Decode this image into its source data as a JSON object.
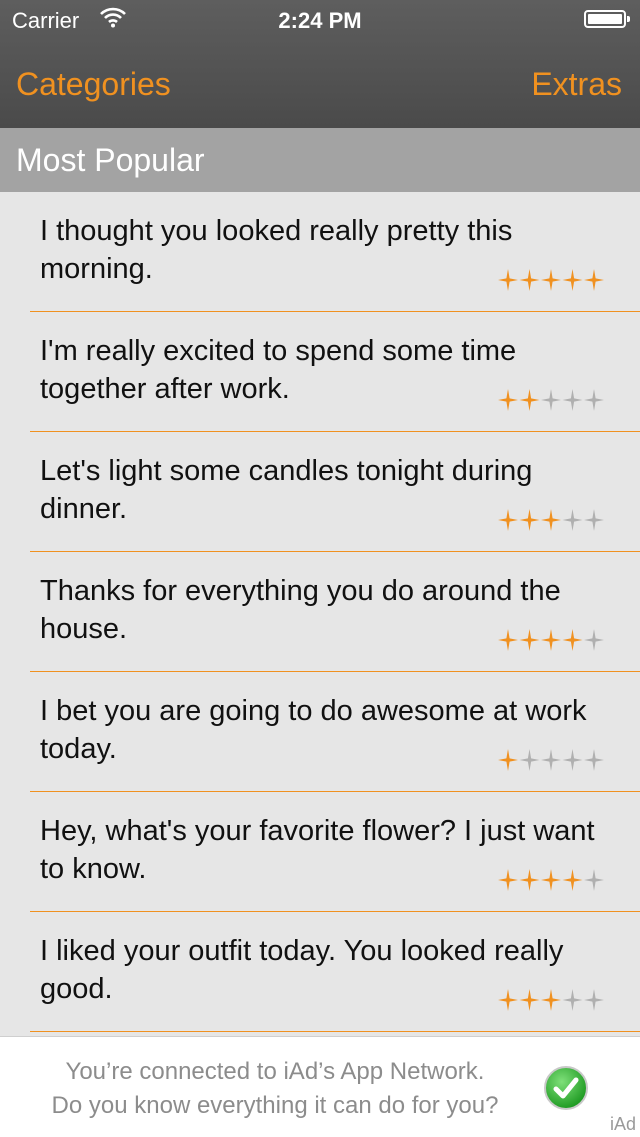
{
  "status_bar": {
    "carrier": "Carrier",
    "time": "2:24 PM",
    "wifi_icon": "wifi-icon",
    "battery_icon": "battery-icon"
  },
  "nav": {
    "left": "Categories",
    "right": "Extras"
  },
  "section": {
    "title": "Most Popular"
  },
  "colors": {
    "accent": "#f09120",
    "star_on": "#f09120",
    "star_off": "#b0b0b0"
  },
  "items": [
    {
      "text": "I thought you looked really pretty this morning.",
      "rating": 5,
      "max": 5
    },
    {
      "text": "I'm really excited to spend some time together after work.",
      "rating": 2,
      "max": 5
    },
    {
      "text": "Let's light some candles tonight during dinner.",
      "rating": 3,
      "max": 5
    },
    {
      "text": "Thanks for everything you do around the house.",
      "rating": 4,
      "max": 5
    },
    {
      "text": "I bet you are going to do awesome at work today.",
      "rating": 1,
      "max": 5
    },
    {
      "text": "Hey, what's your favorite flower? I just want to know.",
      "rating": 4,
      "max": 5
    },
    {
      "text": "I liked your outfit today. You looked really good.",
      "rating": 3,
      "max": 5
    }
  ],
  "ad": {
    "line1": "You’re connected to iAd’s App Network.",
    "line2": "Do you know everything it can do for you?",
    "label": "iAd",
    "check_icon": "checkmark-icon"
  }
}
